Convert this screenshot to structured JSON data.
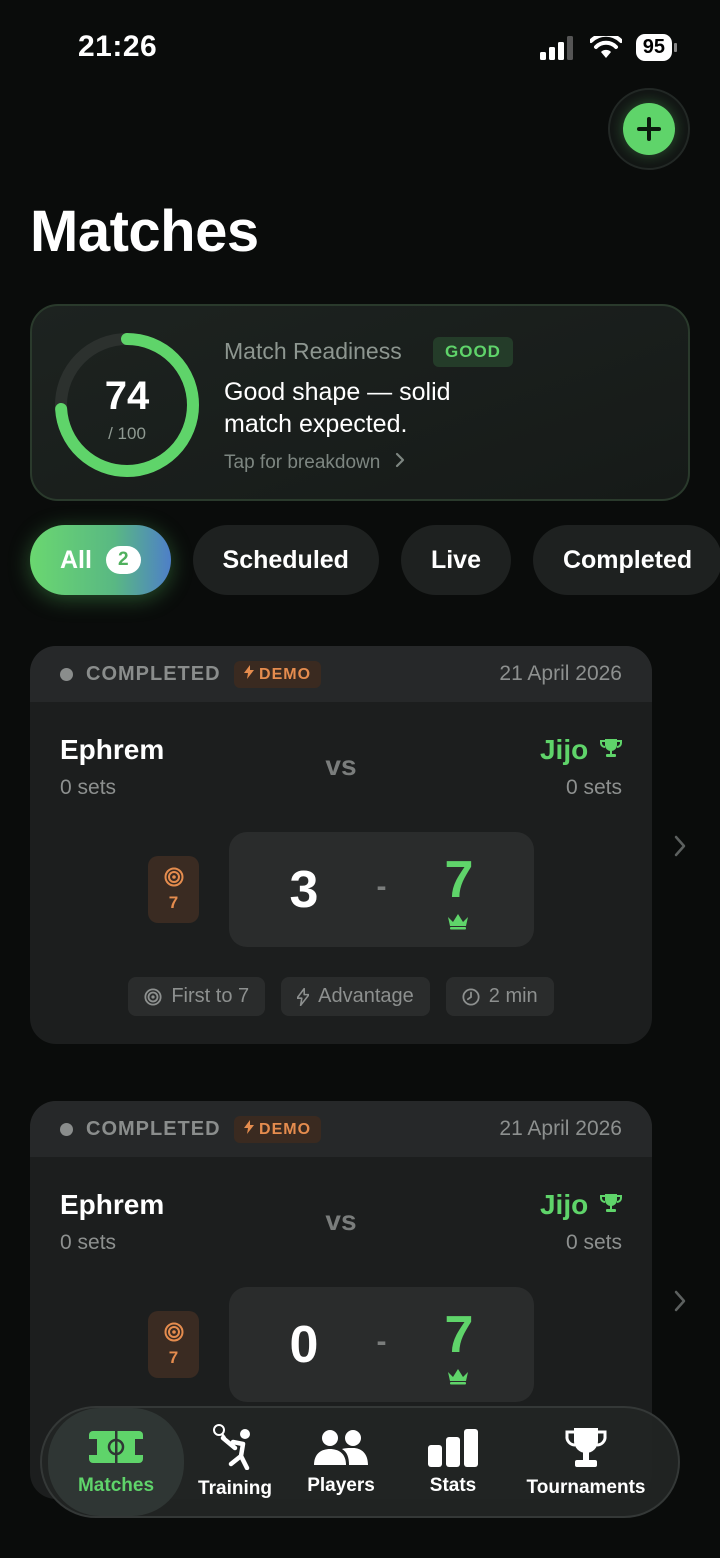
{
  "status_bar": {
    "time": "21:26",
    "battery": "95"
  },
  "page": {
    "title": "Matches"
  },
  "readiness": {
    "score": "74",
    "max": "/ 100",
    "score_fraction": 0.74,
    "label": "Match Readiness",
    "badge": "GOOD",
    "message": "Good shape — solid match expected.",
    "link": "Tap for breakdown"
  },
  "filters": [
    {
      "label": "All",
      "count": "2"
    },
    {
      "label": "Scheduled"
    },
    {
      "label": "Live"
    },
    {
      "label": "Completed"
    }
  ],
  "matches": [
    {
      "status": "COMPLETED",
      "tag": "DEMO",
      "date": "21 April 2026",
      "player1": "Ephrem",
      "player1_sets": "0 sets",
      "vs": "vs",
      "player2": "Jijo",
      "player2_sets": "0 sets",
      "target": "7",
      "score1": "3",
      "separator": "-",
      "score2": "7",
      "rules": [
        "First to 7",
        "Advantage",
        "2 min"
      ]
    },
    {
      "status": "COMPLETED",
      "tag": "DEMO",
      "date": "21 April 2026",
      "player1": "Ephrem",
      "player1_sets": "0 sets",
      "vs": "vs",
      "player2": "Jijo",
      "player2_sets": "0 sets",
      "target": "7",
      "score1": "0",
      "separator": "-",
      "score2": "7"
    }
  ],
  "tabs": [
    {
      "label": "Matches",
      "icon": "court-icon"
    },
    {
      "label": "Training",
      "icon": "player-swing-icon"
    },
    {
      "label": "Players",
      "icon": "people-icon"
    },
    {
      "label": "Stats",
      "icon": "bar-chart-icon"
    },
    {
      "label": "Tournaments",
      "icon": "trophy-icon"
    }
  ],
  "colors": {
    "accent": "#5fd46a",
    "demo": "#e58c4e",
    "background": "#0a0c0b"
  }
}
